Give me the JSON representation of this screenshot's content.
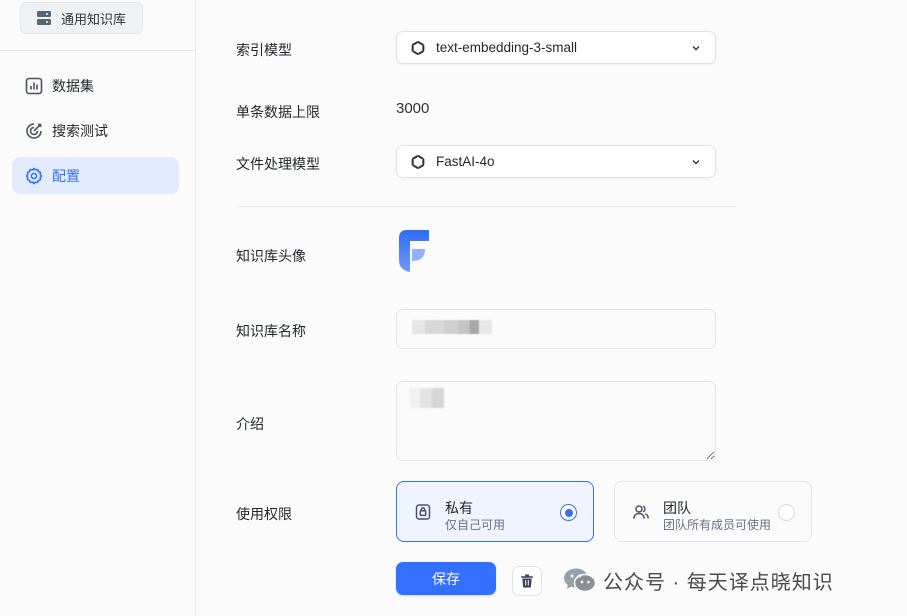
{
  "sidebar": {
    "kb_name": "通用知识库",
    "items": [
      {
        "label": "数据集",
        "icon": "bar-chart-icon",
        "active": false
      },
      {
        "label": "搜索测试",
        "icon": "target-icon",
        "active": false
      },
      {
        "label": "配置",
        "icon": "gear-icon",
        "active": true
      }
    ]
  },
  "form": {
    "index_model": {
      "label": "索引模型",
      "value": "text-embedding-3-small"
    },
    "max_single_data": {
      "label": "单条数据上限",
      "value": "3000"
    },
    "file_model": {
      "label": "文件处理模型",
      "value": "FastAI-4o"
    },
    "avatar": {
      "label": "知识库头像"
    },
    "name": {
      "label": "知识库名称",
      "value": ""
    },
    "intro": {
      "label": "介绍",
      "value": ""
    },
    "permission": {
      "label": "使用权限",
      "options": [
        {
          "title": "私有",
          "desc": "仅自己可用",
          "selected": true,
          "icon": "lock-icon"
        },
        {
          "title": "团队",
          "desc": "团队所有成员可使用",
          "selected": false,
          "icon": "team-icon"
        }
      ]
    }
  },
  "actions": {
    "save_label": "保存",
    "delete_icon": "trash-icon"
  },
  "watermark": {
    "text": "公众号 · 每天译点晓知识"
  },
  "colors": {
    "accent": "#3370ff",
    "active_bg": "#e3ebff",
    "border": "#dfe2ea"
  }
}
